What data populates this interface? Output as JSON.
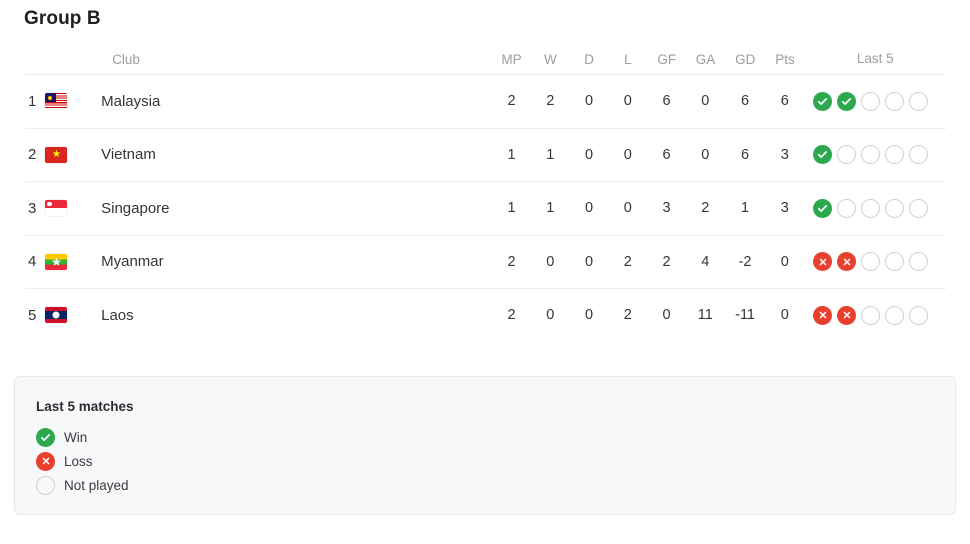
{
  "group": {
    "title": "Group B"
  },
  "table": {
    "headers": {
      "club": "Club",
      "mp": "MP",
      "w": "W",
      "d": "D",
      "l": "L",
      "gf": "GF",
      "ga": "GA",
      "gd": "GD",
      "pts": "Pts",
      "last5": "Last 5"
    },
    "rows": [
      {
        "rank": "1",
        "club": "Malaysia",
        "flag": "flag-my",
        "mp": "2",
        "w": "2",
        "d": "0",
        "l": "0",
        "gf": "6",
        "ga": "0",
        "gd": "6",
        "pts": "6",
        "last5": [
          "win",
          "win",
          "none",
          "none",
          "none"
        ]
      },
      {
        "rank": "2",
        "club": "Vietnam",
        "flag": "flag-vn",
        "mp": "1",
        "w": "1",
        "d": "0",
        "l": "0",
        "gf": "6",
        "ga": "0",
        "gd": "6",
        "pts": "3",
        "last5": [
          "win",
          "none",
          "none",
          "none",
          "none"
        ]
      },
      {
        "rank": "3",
        "club": "Singapore",
        "flag": "flag-sg",
        "mp": "1",
        "w": "1",
        "d": "0",
        "l": "0",
        "gf": "3",
        "ga": "2",
        "gd": "1",
        "pts": "3",
        "last5": [
          "win",
          "none",
          "none",
          "none",
          "none"
        ]
      },
      {
        "rank": "4",
        "club": "Myanmar",
        "flag": "flag-mm",
        "mp": "2",
        "w": "0",
        "d": "0",
        "l": "2",
        "gf": "2",
        "ga": "4",
        "gd": "-2",
        "pts": "0",
        "last5": [
          "loss",
          "loss",
          "none",
          "none",
          "none"
        ]
      },
      {
        "rank": "5",
        "club": "Laos",
        "flag": "flag-la",
        "mp": "2",
        "w": "0",
        "d": "0",
        "l": "2",
        "gf": "0",
        "ga": "11",
        "gd": "-11",
        "pts": "0",
        "last5": [
          "loss",
          "loss",
          "none",
          "none",
          "none"
        ]
      }
    ]
  },
  "legend": {
    "title": "Last 5 matches",
    "items": [
      {
        "type": "win",
        "label": "Win"
      },
      {
        "type": "loss",
        "label": "Loss"
      },
      {
        "type": "none",
        "label": "Not played"
      }
    ]
  },
  "colors": {
    "win": "#2ca94f",
    "loss": "#e8402e",
    "not_played_border": "#cdd0d5",
    "text": "#34363a",
    "muted": "#9a9da3",
    "legend_bg": "#f7f8fa",
    "row_divider": "#eceef1"
  }
}
